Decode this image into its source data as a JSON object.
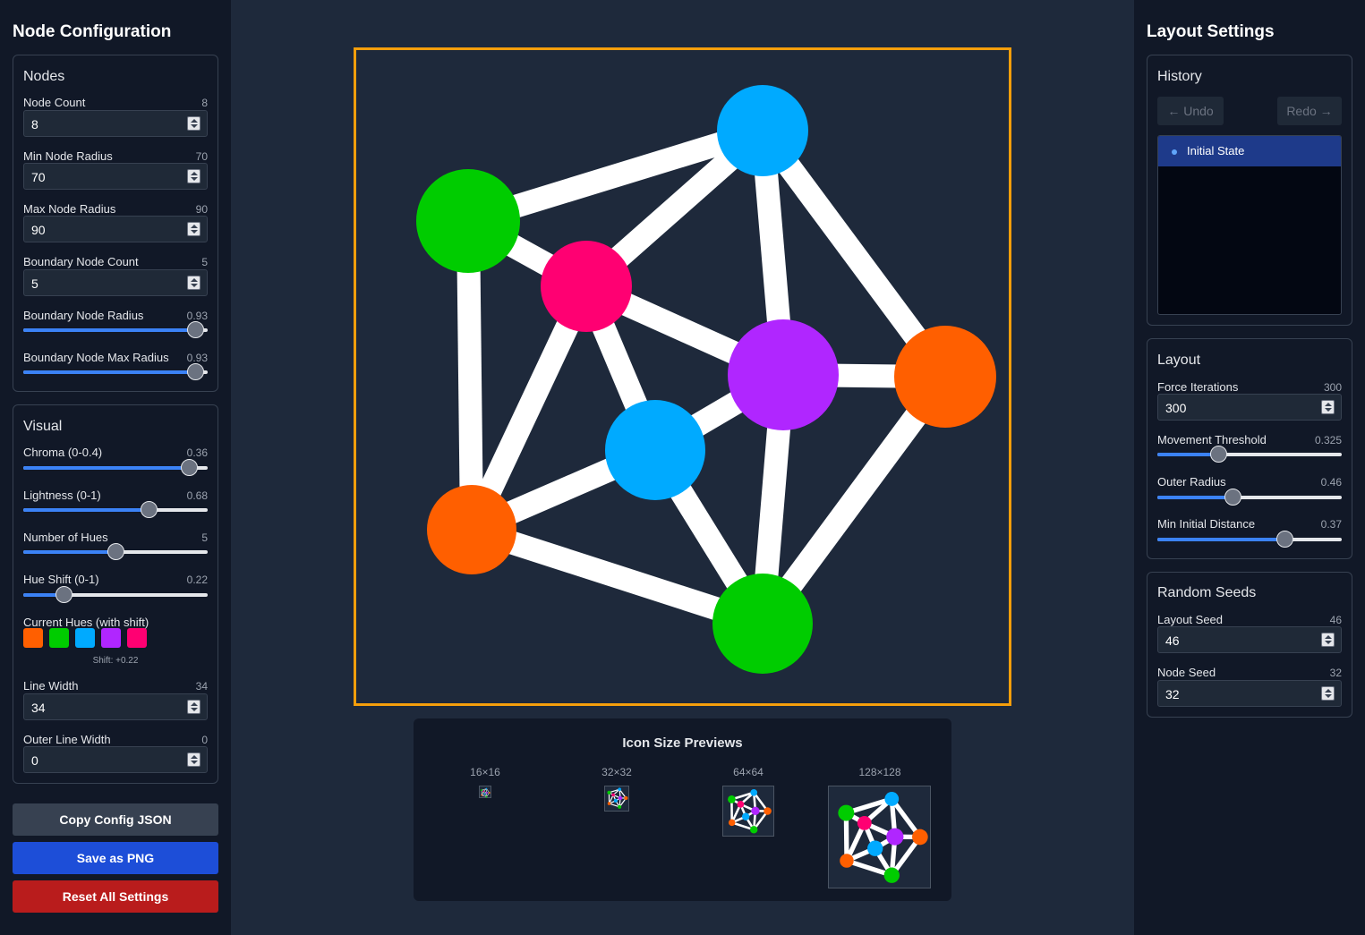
{
  "left_sidebar": {
    "title": "Node Configuration",
    "nodes_panel": {
      "title": "Nodes",
      "node_count": {
        "label": "Node Count",
        "value": "8"
      },
      "min_node_radius": {
        "label": "Min Node Radius",
        "value": "70"
      },
      "max_node_radius": {
        "label": "Max Node Radius",
        "value": "90"
      },
      "boundary_node_count": {
        "label": "Boundary Node Count",
        "value": "5"
      },
      "boundary_node_radius": {
        "label": "Boundary Node Radius",
        "value": "0.93",
        "fraction": 0.93
      },
      "boundary_node_max_radius": {
        "label": "Boundary Node Max Radius",
        "value": "0.93",
        "fraction": 0.93
      }
    },
    "visual_panel": {
      "title": "Visual",
      "chroma": {
        "label": "Chroma (0-0.4)",
        "value": "0.36",
        "fraction": 0.9
      },
      "lightness": {
        "label": "Lightness (0-1)",
        "value": "0.68",
        "fraction": 0.68
      },
      "number_of_hues": {
        "label": "Number of Hues",
        "value": "5",
        "fraction": 0.5
      },
      "hue_shift": {
        "label": "Hue Shift (0-1)",
        "value": "0.22",
        "fraction": 0.22
      },
      "current_hues": {
        "label": "Current Hues (with shift)",
        "colors": [
          "#ff5f00",
          "#00cc00",
          "#00aaff",
          "#b026ff",
          "#ff0072"
        ],
        "shift_note": "Shift: +0.22"
      },
      "line_width": {
        "label": "Line Width",
        "value": "34"
      },
      "outer_line_width": {
        "label": "Outer Line Width",
        "value": "0"
      }
    },
    "buttons": {
      "copy_config": "Copy Config JSON",
      "save_png": "Save as PNG",
      "reset": "Reset All Settings"
    }
  },
  "previews": {
    "title": "Icon Size Previews",
    "sizes": [
      "16×16",
      "32×32",
      "64×64",
      "128×128"
    ]
  },
  "right_sidebar": {
    "title": "Layout Settings",
    "history_panel": {
      "title": "History",
      "undo": "Undo",
      "redo": "Redo",
      "entries": [
        "Initial State"
      ]
    },
    "layout_panel": {
      "title": "Layout",
      "force_iterations": {
        "label": "Force Iterations",
        "value": "300"
      },
      "movement_threshold": {
        "label": "Movement Threshold",
        "value": "0.325",
        "fraction": 0.33
      },
      "outer_radius": {
        "label": "Outer Radius",
        "value": "0.46",
        "fraction": 0.41
      },
      "min_initial_distance": {
        "label": "Min Initial Distance",
        "value": "0.37",
        "fraction": 0.69
      }
    },
    "seeds_panel": {
      "title": "Random Seeds",
      "layout_seed": {
        "label": "Layout Seed",
        "value": "46"
      },
      "node_seed": {
        "label": "Node Seed",
        "value": "32"
      }
    }
  },
  "graph": {
    "nodes": [
      {
        "id": "n1",
        "color": "#00aaff"
      },
      {
        "id": "n2",
        "color": "#00cc00"
      },
      {
        "id": "n3",
        "color": "#ff0072"
      },
      {
        "id": "n4",
        "color": "#b026ff"
      },
      {
        "id": "n5",
        "color": "#ff5f00"
      },
      {
        "id": "n6",
        "color": "#00aaff"
      },
      {
        "id": "n7",
        "color": "#ff5f00"
      },
      {
        "id": "n8",
        "color": "#00cc00"
      }
    ],
    "edges": [
      [
        "n2",
        "n1"
      ],
      [
        "n3",
        "n1"
      ],
      [
        "n1",
        "n4"
      ],
      [
        "n1",
        "n5"
      ],
      [
        "n2",
        "n3"
      ],
      [
        "n2",
        "n7"
      ],
      [
        "n3",
        "n4"
      ],
      [
        "n3",
        "n6"
      ],
      [
        "n3",
        "n7"
      ],
      [
        "n4",
        "n5"
      ],
      [
        "n4",
        "n6"
      ],
      [
        "n4",
        "n8"
      ],
      [
        "n5",
        "n8"
      ],
      [
        "n6",
        "n7"
      ],
      [
        "n6",
        "n8"
      ],
      [
        "n7",
        "n8"
      ]
    ],
    "edge_color": "#ffffff"
  }
}
